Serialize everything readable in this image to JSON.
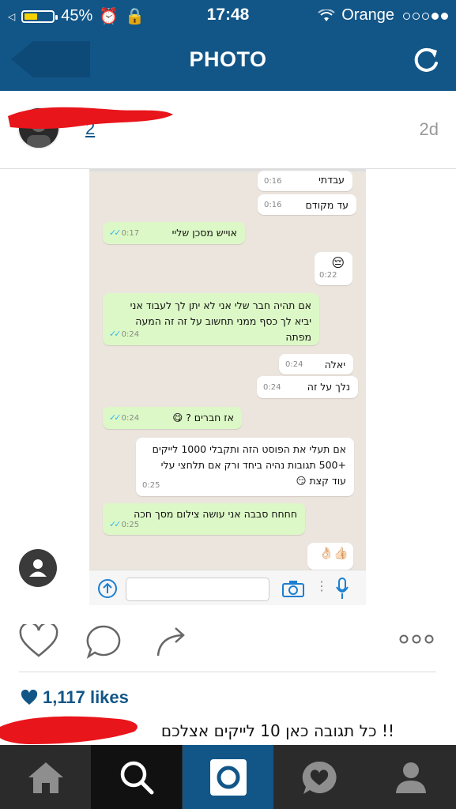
{
  "status": {
    "battery": "45%",
    "time": "17:48",
    "carrier": "Orange"
  },
  "navbar": {
    "title": "PHOTO"
  },
  "post": {
    "username_visible": "2",
    "time_ago": "2d",
    "likes": "1,117 likes",
    "caption": "!! כל תגובה כאן 10 לייקים אצלכם"
  },
  "chat": {
    "messages": [
      {
        "dir": "in",
        "text": "עבדתי",
        "time": "0:16"
      },
      {
        "dir": "in",
        "text": "עד מקודם",
        "time": "0:16"
      },
      {
        "dir": "out",
        "text": "אוייש מסכן שליי",
        "time": "0:17"
      },
      {
        "dir": "in",
        "text": "😔",
        "time": "0:22"
      },
      {
        "dir": "out",
        "text": "אם תהיה חבר שלי אני לא יתן לך לעבוד אני יביא לך כסף ממני תחשוב על זה זה המעה מפתה",
        "time": "0:24"
      },
      {
        "dir": "in",
        "text": "יאלה",
        "time": "0:24"
      },
      {
        "dir": "in",
        "text": "נלך על זה",
        "time": "0:24"
      },
      {
        "dir": "out",
        "text": "אז חברים ? 😋",
        "time": "0:24"
      },
      {
        "dir": "in",
        "text": "אם תעלי את הפוסט הזה ותקבלי 1000 לייקים +500 תגובות נהיה ביחד ורק אם תלחצי עלי עוד קצת 😏",
        "time": "0:25"
      },
      {
        "dir": "out",
        "text": "חחחח סבבה אני עושה צילום מסך חכה",
        "time": "0:25"
      },
      {
        "dir": "in",
        "text": "👍🏻👌🏻",
        "time": ""
      }
    ]
  },
  "icons": {
    "back": "back-arrow-icon",
    "refresh": "refresh-icon",
    "like": "heart-icon",
    "comment": "comment-icon",
    "share": "share-icon",
    "more": "more-icon",
    "tabs": [
      "home-icon",
      "search-icon",
      "camera-icon",
      "activity-icon",
      "profile-icon"
    ]
  },
  "colors": {
    "brand": "#125688",
    "tabbar": "#2b2b2b",
    "bubble_out": "#dcf8c6",
    "bubble_in": "#ffffff",
    "chat_bg": "#ece5dd"
  }
}
